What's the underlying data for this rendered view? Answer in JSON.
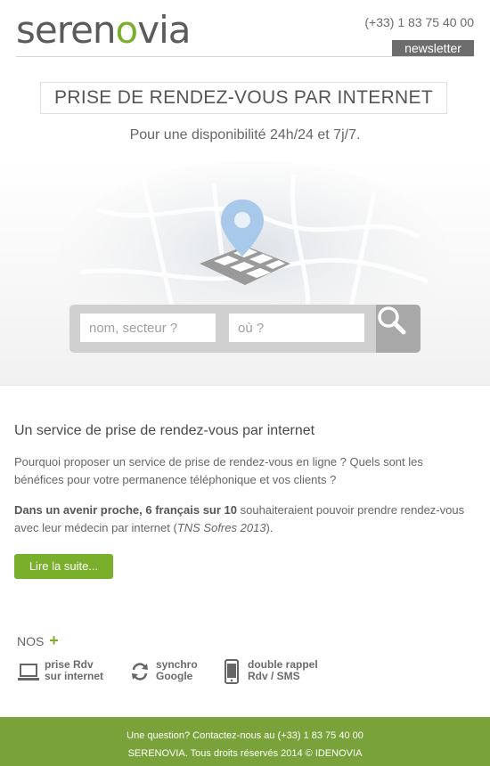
{
  "header": {
    "logo_prefix": "seren",
    "logo_accent": "o",
    "logo_suffix": "via",
    "phone": "(+33) 1 83 75 40 00",
    "newsletter_label": "newsletter"
  },
  "hero": {
    "title": "PRISE DE RENDEZ-VOUS PAR INTERNET",
    "subtitle": "Pour une disponibilité 24h/24 et 7j/7.",
    "search_name_placeholder": "nom, secteur ?",
    "search_where_placeholder": "où ?",
    "search_icon": "search-icon"
  },
  "content": {
    "title": "Un service de prise de rendez-vous par internet",
    "para1": "Pourquoi proposer un service de prise de rendez-vous en ligne ? Quels sont les bénéfices pour votre permanence téléphonique et vos clients ?",
    "para2_bold": "Dans un avenir proche, 6 français sur 10",
    "para2_rest": " souhaiteraient pouvoir prendre rendez-vous avec leur médecin par internet (",
    "para2_italic": "TNS Sofres 2013",
    "para2_end": ").",
    "read_more": "Lire la suite..."
  },
  "features": {
    "heading": "NOS",
    "plus": "+",
    "items": [
      {
        "icon": "laptop-icon",
        "line1": "prise Rdv",
        "line2": "sur internet"
      },
      {
        "icon": "sync-icon",
        "line1": "synchro",
        "line2": "Google"
      },
      {
        "icon": "phone-icon",
        "line1": "double rappel",
        "line2": "Rdv / SMS"
      }
    ]
  },
  "footer": {
    "line1": "Une question? Contactez-nous au (+33) 1 83 75 40 00",
    "line2": "SERENOVIA. Tous droits réservés 2014 © IDENOVIA"
  },
  "colors": {
    "brand_green": "#7aaf2c",
    "footer_green": "#79a33a",
    "newsletter_bg": "#6d6d6d",
    "pin_blue": "#a9c9ea"
  }
}
